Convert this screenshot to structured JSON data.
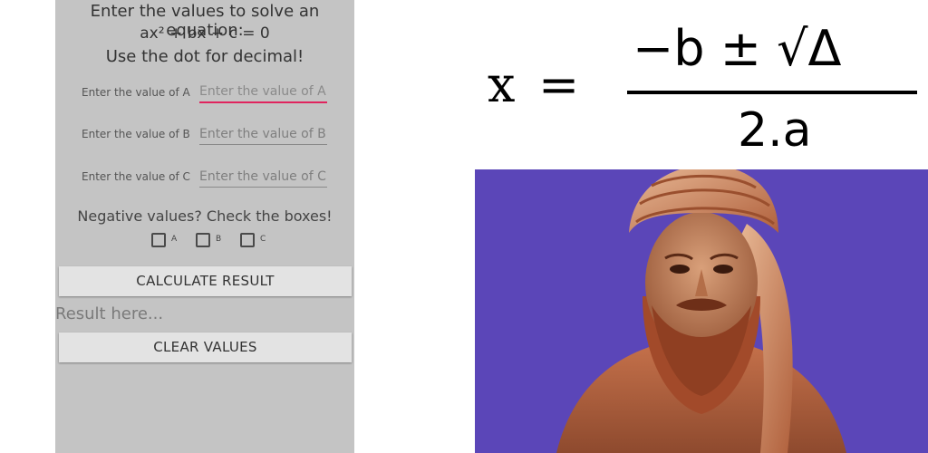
{
  "app": {
    "title_line1": "Enter the values to solve an equation:",
    "title_line2": "ax² + bx + c = 0",
    "title_line3": "Use the dot for decimal!",
    "fields": [
      {
        "label": "Enter the value of A",
        "placeholder": "Enter the value of A"
      },
      {
        "label": "Enter the value of B",
        "placeholder": "Enter the value of B"
      },
      {
        "label": "Enter the value of C",
        "placeholder": "Enter the value of C"
      }
    ],
    "negative_prompt": "Negative values? Check the boxes!",
    "checkboxes": [
      {
        "label": "A",
        "checked": false
      },
      {
        "label": "B",
        "checked": false
      },
      {
        "label": "C",
        "checked": false
      }
    ],
    "calculate_label": "CALCULATE RESULT",
    "result_text": "Result here...",
    "clear_label": "CLEAR VALUES",
    "accent_color": "#e0245e",
    "background_color": "#c4c4c4"
  },
  "formula": {
    "lhs": "x",
    "equals": "=",
    "numerator": "−b ± √Δ",
    "denominator": "2.a"
  },
  "portrait": {
    "background_color": "#5b46b8"
  }
}
